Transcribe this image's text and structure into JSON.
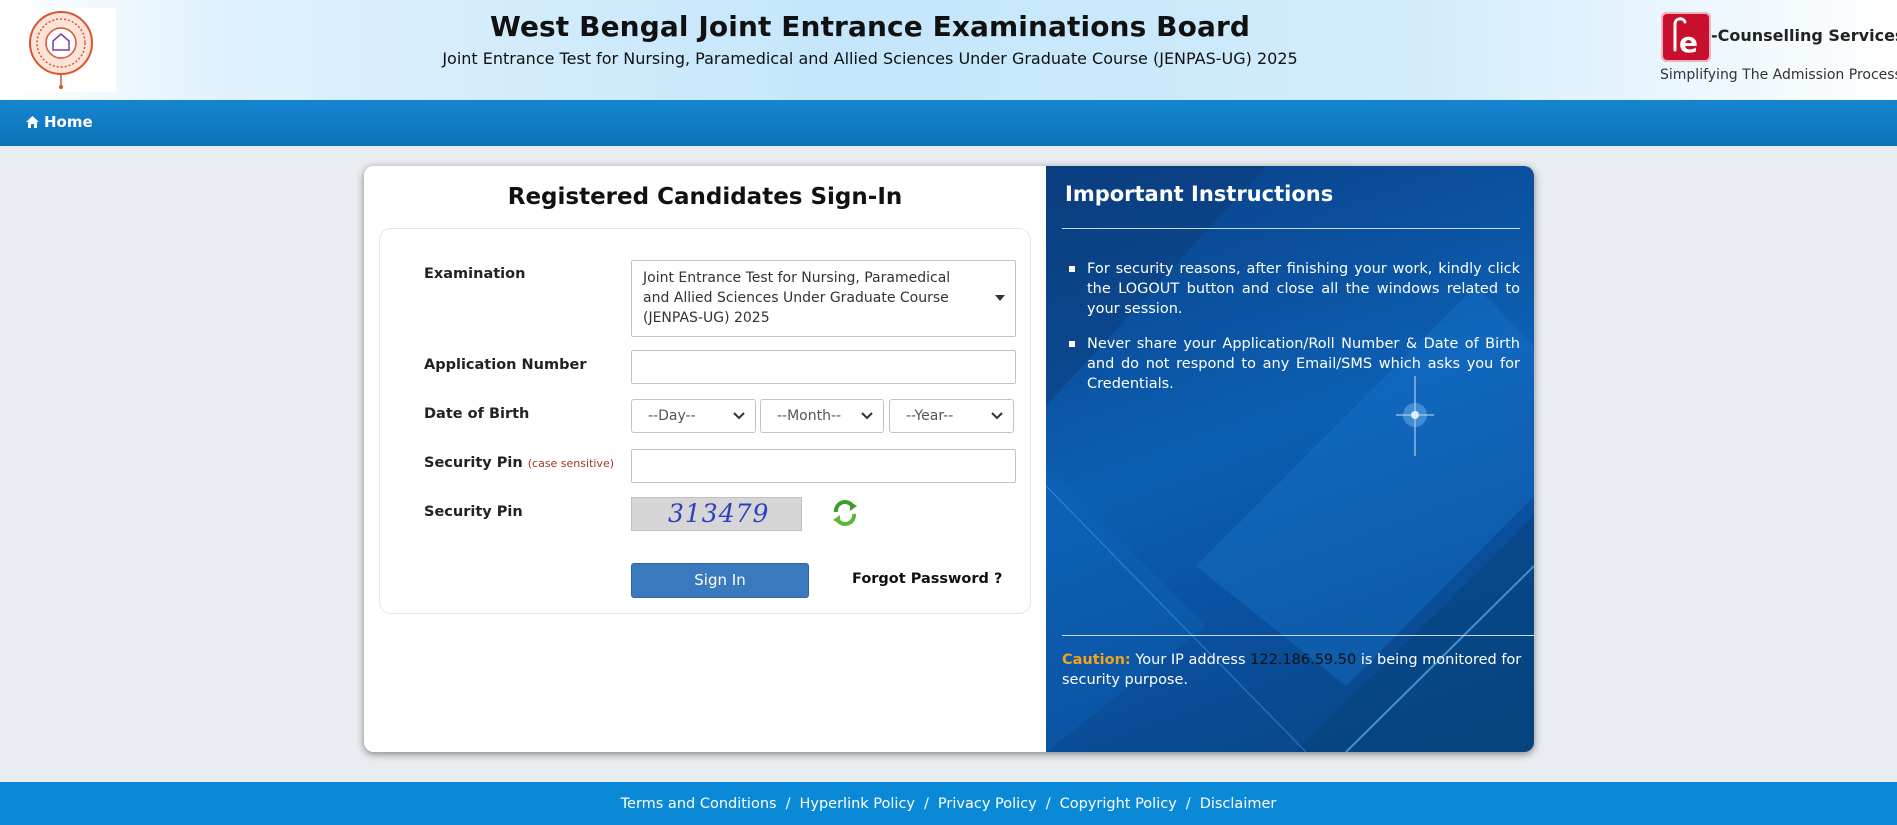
{
  "header": {
    "title": "West Bengal Joint Entrance Examinations Board",
    "subtitle": "Joint Entrance Test for Nursing, Paramedical and Allied Sciences Under Graduate Course (JENPAS-UG) 2025",
    "logo_left": "wbjeeb-seal-logo",
    "brand": {
      "letter": "e",
      "name": "-Counselling Services",
      "tagline": "Simplifying The Admission Process",
      "color": "#c8102e"
    }
  },
  "nav": {
    "home_icon": "home-icon",
    "home_label": "Home"
  },
  "signin": {
    "title": "Registered Candidates Sign-In",
    "examination_label": "Examination",
    "examination_value": "Joint Entrance Test for Nursing, Paramedical and Allied Sciences Under Graduate Course (JENPAS-UG) 2025",
    "application_label": "Application Number",
    "application_value": "",
    "dob_label": "Date of Birth",
    "day_placeholder": "--Day--",
    "month_placeholder": "--Month--",
    "year_placeholder": "--Year--",
    "pin_label": "Security Pin",
    "pin_note": "(case sensitive)",
    "pin_value": "",
    "captcha_label": "Security Pin",
    "captcha_text": "313479",
    "refresh_icon": "refresh-icon",
    "signin_button": "Sign In",
    "forgot_link": "Forgot Password ?",
    "button_color": "#3a79bd"
  },
  "instructions": {
    "title": "Important Instructions",
    "items": [
      "For security reasons, after finishing your work, kindly click the LOGOUT button and close all the windows related to your session.",
      "Never share your Application/Roll Number & Date of Birth and do not respond to any Email/SMS which asks you for Credentials."
    ],
    "caution_label": "Caution:",
    "caution_pre": "Your IP address",
    "ip": "122.186.59.50",
    "caution_post": "is being monitored for security purpose.",
    "caution_color": "#f2a21b"
  },
  "footer": {
    "links": [
      "Terms and Conditions",
      "Hyperlink Policy",
      "Privacy Policy",
      "Copyright Policy",
      "Disclaimer"
    ],
    "separator": "/"
  }
}
